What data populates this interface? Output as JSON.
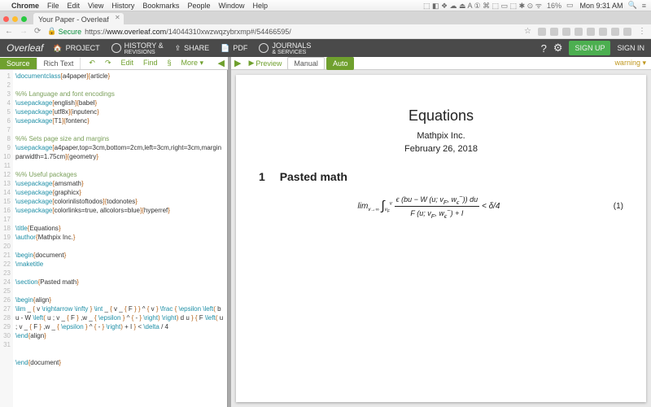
{
  "mac": {
    "app": "Chrome",
    "menus": [
      "File",
      "Edit",
      "View",
      "History",
      "Bookmarks",
      "People",
      "Window",
      "Help"
    ],
    "battery": "16%",
    "clock": "Mon 9:31 AM"
  },
  "chrome": {
    "tab_title": "Your Paper - Overleaf",
    "secure_label": "Secure",
    "url_prefix": "https://",
    "url_domain": "www.overleaf.com",
    "url_path": "/14044310xwzwqzybrxmp#/54466595/"
  },
  "overleaf": {
    "logo": "Overleaf",
    "top_items": {
      "project": "PROJECT",
      "history": "HISTORY &",
      "history_sub": "REVISIONS",
      "share": "SHARE",
      "pdf": "PDF",
      "journals": "JOURNALS",
      "journals_sub": "& SERVICES"
    },
    "signup": "SIGN UP",
    "signin": "SIGN IN"
  },
  "toolbar": {
    "source": "Source",
    "richtext": "Rich Text",
    "edit": "Edit",
    "find": "Find",
    "section_sym": "§",
    "more": "More"
  },
  "preview_toolbar": {
    "preview": "Preview",
    "manual": "Manual",
    "auto": "Auto",
    "warning": "warning"
  },
  "code": {
    "lines": [
      {
        "n": 1,
        "t": "cmd",
        "cmd": "\\documentclass",
        "br": "[a4paper]{article}"
      },
      {
        "n": 2,
        "t": "blank"
      },
      {
        "n": 3,
        "t": "comment",
        "text": "%% Language and font encodings"
      },
      {
        "n": 4,
        "t": "cmd",
        "cmd": "\\usepackage",
        "br": "[english]{babel}"
      },
      {
        "n": 5,
        "t": "cmd",
        "cmd": "\\usepackage",
        "br": "[utf8x]{inputenc}"
      },
      {
        "n": 6,
        "t": "cmd",
        "cmd": "\\usepackage",
        "br": "[T1]{fontenc}"
      },
      {
        "n": 7,
        "t": "blank"
      },
      {
        "n": 8,
        "t": "comment",
        "text": "%% Sets page size and margins"
      },
      {
        "n": 9,
        "t": "cmd",
        "cmd": "\\usepackage",
        "br": "[a4paper,top=3cm,bottom=2cm,left=3cm,right=3cm,marginparwidth=1.75cm]{geometry}"
      },
      {
        "n": 10,
        "t": "cont"
      },
      {
        "n": 11,
        "t": "blank"
      },
      {
        "n": 12,
        "t": "comment",
        "text": "%% Useful packages"
      },
      {
        "n": 13,
        "t": "cmd",
        "cmd": "\\usepackage",
        "br": "{amsmath}"
      },
      {
        "n": 14,
        "t": "cmd",
        "cmd": "\\usepackage",
        "br": "{graphicx}"
      },
      {
        "n": 15,
        "t": "cmd",
        "cmd": "\\usepackage",
        "br": "[colorinlistoftodos]{todonotes}"
      },
      {
        "n": 16,
        "t": "cmd",
        "cmd": "\\usepackage",
        "br": "[colorlinks=true, allcolors=blue]{hyperref}"
      },
      {
        "n": 17,
        "t": "blank"
      },
      {
        "n": 18,
        "t": "cmd",
        "cmd": "\\title",
        "br": "{Equations}"
      },
      {
        "n": 19,
        "t": "cmd",
        "cmd": "\\author",
        "br": "{Mathpix Inc.}"
      },
      {
        "n": 20,
        "t": "blank"
      },
      {
        "n": 21,
        "t": "cmd",
        "cmd": "\\begin",
        "br": "{document}"
      },
      {
        "n": 22,
        "t": "cmd",
        "cmd": "\\maketitle",
        "br": ""
      },
      {
        "n": 23,
        "t": "blank"
      },
      {
        "n": 24,
        "t": "cmd",
        "cmd": "\\section",
        "br": "{Pasted math}",
        "fold": true
      },
      {
        "n": 25,
        "t": "blank"
      },
      {
        "n": 26,
        "t": "cmd",
        "cmd": "\\begin",
        "br": "{align}"
      },
      {
        "n": 27,
        "t": "math",
        "text": "\\lim _ { v \\rightarrow \\infty } \\int _ { v _ { F } } ^ { v } \\frac { \\epsilon \\left( b u - W \\left( u ; v _ { F } ,w _ { \\epsilon } ^ { - } \\right) \\right) d u } { F \\left( u ; v _ { F } ,w _ { \\epsilon } ^ { - } \\right) + I } < \\delta / 4"
      },
      {
        "n": 28,
        "t": "cmd",
        "cmd": "\\end",
        "br": "{align}"
      },
      {
        "n": 29,
        "t": "blank"
      },
      {
        "n": 30,
        "t": "blank"
      },
      {
        "n": 31,
        "t": "cmd",
        "cmd": "\\end",
        "br": "{document}"
      }
    ]
  },
  "doc": {
    "title": "Equations",
    "author": "Mathpix Inc.",
    "date": "February 26, 2018",
    "section_num": "1",
    "section_title": "Pasted math",
    "eq_num": "(1)",
    "eq_rhs": "< δ/4"
  }
}
